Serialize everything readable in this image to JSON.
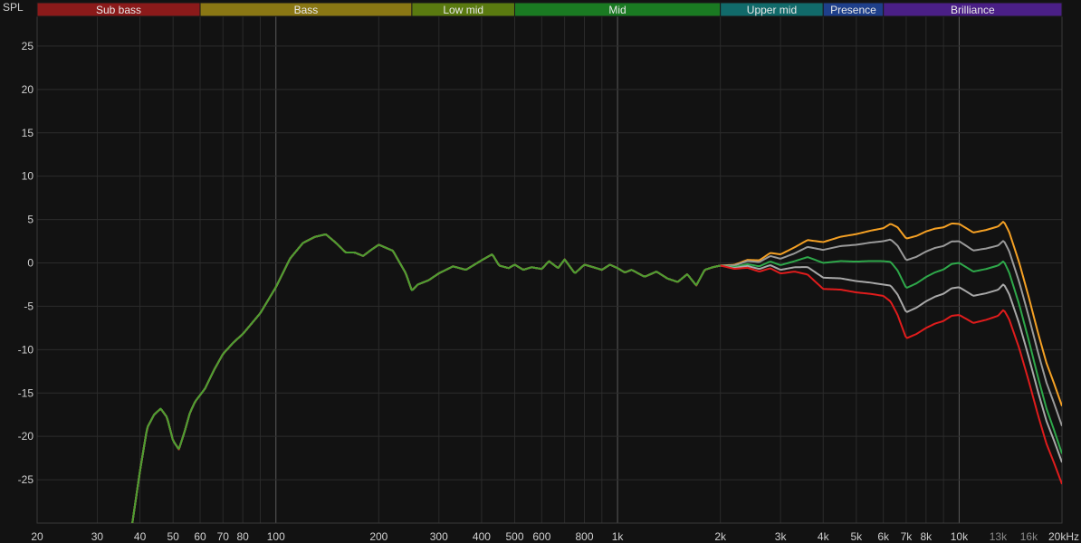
{
  "chart_data": {
    "type": "line",
    "ylabel": "SPL",
    "x_scale": "log",
    "xlim": [
      20,
      20000
    ],
    "ylim": [
      -30,
      30
    ],
    "grid": true,
    "legend": "none",
    "x_ticks": [
      {
        "value": 20,
        "label": "20"
      },
      {
        "value": 30,
        "label": "30"
      },
      {
        "value": 40,
        "label": "40"
      },
      {
        "value": 50,
        "label": "50"
      },
      {
        "value": 60,
        "label": "60"
      },
      {
        "value": 70,
        "label": "70"
      },
      {
        "value": 80,
        "label": "80"
      },
      {
        "value": 100,
        "label": "100"
      },
      {
        "value": 200,
        "label": "200"
      },
      {
        "value": 300,
        "label": "300"
      },
      {
        "value": 400,
        "label": "400"
      },
      {
        "value": 500,
        "label": "500"
      },
      {
        "value": 600,
        "label": "600"
      },
      {
        "value": 800,
        "label": "800"
      },
      {
        "value": 1000,
        "label": "1k"
      },
      {
        "value": 2000,
        "label": "2k"
      },
      {
        "value": 3000,
        "label": "3k"
      },
      {
        "value": 4000,
        "label": "4k"
      },
      {
        "value": 5000,
        "label": "5k"
      },
      {
        "value": 6000,
        "label": "6k"
      },
      {
        "value": 7000,
        "label": "7k"
      },
      {
        "value": 8000,
        "label": "8k"
      },
      {
        "value": 10000,
        "label": "10k"
      },
      {
        "value": 13000,
        "label": "13k",
        "dim": true
      },
      {
        "value": 16000,
        "label": "16k",
        "dim": true
      },
      {
        "value": 20000,
        "label": "20kHz"
      }
    ],
    "y_ticks": [
      25,
      20,
      15,
      10,
      5,
      0,
      -5,
      -10,
      -15,
      -20,
      -25
    ],
    "bands": [
      {
        "label": "Sub bass",
        "from": 20,
        "to": 60,
        "color": "#8b1a1a"
      },
      {
        "label": "Bass",
        "from": 60,
        "to": 250,
        "color": "#8a7714"
      },
      {
        "label": "Low mid",
        "from": 250,
        "to": 500,
        "color": "#5a7a10"
      },
      {
        "label": "Mid",
        "from": 500,
        "to": 2000,
        "color": "#1a7a22"
      },
      {
        "label": "Upper mid",
        "from": 2000,
        "to": 4000,
        "color": "#116a6a"
      },
      {
        "label": "Presence",
        "from": 4000,
        "to": 6000,
        "color": "#1e3f8a"
      },
      {
        "label": "Brilliance",
        "from": 6000,
        "to": 20000,
        "color": "#4a1f86"
      }
    ],
    "base_curve": {
      "x": [
        38,
        40,
        42,
        44,
        46,
        48,
        50,
        52,
        54,
        56,
        58,
        62,
        66,
        70,
        75,
        80,
        90,
        100,
        110,
        120,
        130,
        140,
        150,
        160,
        170,
        180,
        190,
        200,
        220,
        240,
        250,
        260,
        280,
        300,
        330,
        360,
        400,
        430,
        450,
        480,
        500,
        530,
        560,
        600,
        630,
        670,
        700,
        750,
        800,
        850,
        900,
        950,
        1000,
        1050,
        1100,
        1200,
        1300,
        1400,
        1500,
        1600,
        1700,
        1800,
        1900,
        2000,
        2200,
        2400,
        2600,
        2800,
        3000,
        3300,
        3600,
        4000,
        4500,
        5000,
        5500,
        6000,
        6300,
        6600,
        7000,
        7500,
        8000,
        8500,
        9000,
        9500,
        10000,
        10500,
        11000,
        12000,
        13000,
        13500,
        14000,
        15000,
        16000,
        17000,
        18000,
        19000,
        20000
      ],
      "y": [
        -30,
        -24,
        -19,
        -17.5,
        -16.8,
        -17.8,
        -20.5,
        -21.5,
        -19.5,
        -17.3,
        -16,
        -14.5,
        -12.3,
        -10.5,
        -9.2,
        -8.2,
        -5.8,
        -2.8,
        0.5,
        2.3,
        3,
        3.3,
        2.3,
        1.2,
        1.2,
        0.8,
        1.5,
        2.1,
        1.4,
        -1.2,
        -3.2,
        -2.5,
        -2.0,
        -1.2,
        -0.4,
        -0.8,
        0.3,
        1.0,
        -0.3,
        -0.6,
        -0.2,
        -0.8,
        -0.5,
        -0.7,
        0.2,
        -0.6,
        0.4,
        -1.2,
        -0.2,
        -0.5,
        -0.8,
        -0.2,
        -0.6,
        -1.1,
        -0.8,
        -1.6,
        -1.0,
        -1.8,
        -2.2,
        -1.3,
        -2.6,
        -0.8,
        -0.5,
        -0.3,
        -0.4,
        0.0,
        -0.2,
        0.4,
        0.0,
        0.5,
        1.2,
        0.8,
        1.3,
        1.5,
        1.8,
        2.0,
        2.2,
        1.5,
        -0.2,
        0.3,
        1.0,
        1.5,
        1.8,
        2.4,
        2.5,
        2.0,
        1.5,
        1.8,
        2.2,
        2.8,
        1.6,
        -2.0,
        -6.0,
        -10.0,
        -13.5,
        -16.0,
        -18.5
      ],
      "note_free": true
    },
    "series": [
      {
        "color": "#f4a024",
        "offsets": [
          [
            2000,
            0
          ],
          [
            2600,
            0.5
          ],
          [
            3300,
            1.3
          ],
          [
            4000,
            1.6
          ],
          [
            6000,
            2.0
          ],
          [
            7000,
            3.0
          ],
          [
            10000,
            2.0
          ],
          [
            13000,
            2.0
          ],
          [
            20000,
            2.0
          ]
        ]
      },
      {
        "color": "#9a9a9a",
        "offsets": [
          [
            2000,
            0
          ],
          [
            2600,
            0.3
          ],
          [
            3300,
            0.6
          ],
          [
            4000,
            0.7
          ],
          [
            6000,
            0.5
          ],
          [
            7000,
            0.5
          ],
          [
            10000,
            0
          ],
          [
            13000,
            -0.2
          ],
          [
            20000,
            -0.3
          ]
        ]
      },
      {
        "color": "#2ea84a",
        "offsets": [
          [
            2000,
            0
          ],
          [
            2600,
            -0.2
          ],
          [
            3300,
            -0.3
          ],
          [
            4000,
            -0.8
          ],
          [
            6000,
            -1.8
          ],
          [
            7000,
            -2.7
          ],
          [
            10000,
            -2.5
          ],
          [
            13000,
            -2.5
          ],
          [
            20000,
            -3.5
          ]
        ]
      },
      {
        "color": "#a8a8a8",
        "offsets": [
          [
            2000,
            0
          ],
          [
            2600,
            -0.5
          ],
          [
            3300,
            -1.0
          ],
          [
            4000,
            -2.5
          ],
          [
            6000,
            -4.5
          ],
          [
            7000,
            -5.5
          ],
          [
            10000,
            -5.3
          ],
          [
            13000,
            -5.3
          ],
          [
            20000,
            -4.5
          ]
        ]
      },
      {
        "color": "#e01c1c",
        "offsets": [
          [
            2000,
            0
          ],
          [
            2600,
            -0.8
          ],
          [
            3300,
            -1.5
          ],
          [
            4000,
            -3.8
          ],
          [
            6000,
            -5.8
          ],
          [
            7000,
            -8.5
          ],
          [
            10000,
            -8.5
          ],
          [
            13000,
            -8.3
          ],
          [
            20000,
            -7.0
          ]
        ]
      },
      {
        "color": "#4aa030",
        "offsets": [
          [
            2000,
            0
          ],
          [
            20000,
            0
          ]
        ],
        "low_only": true
      }
    ]
  }
}
